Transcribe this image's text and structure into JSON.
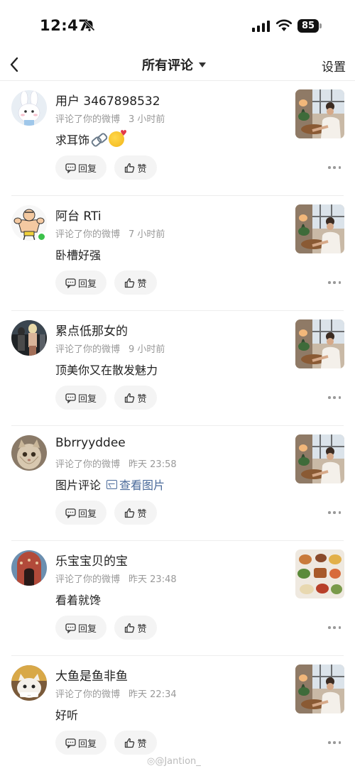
{
  "status_bar": {
    "time": "12:47",
    "battery": "85"
  },
  "nav": {
    "title": "所有评论",
    "settings": "设置"
  },
  "comments": [
    {
      "username": "用户 3467898532",
      "action": "评论了你的微博",
      "time": "3 小时前",
      "text": "求耳饰",
      "emoji": [
        "link-emoji",
        "kissing-face-emoji"
      ],
      "reply": "回复",
      "like": "赞",
      "thumb": "photo-man-at-window"
    },
    {
      "username": "阿台 RTi",
      "action": "评论了你的微博",
      "time": "7 小时前",
      "text": "卧槽好强",
      "reply": "回复",
      "like": "赞",
      "thumb": "photo-man-at-window",
      "online": true
    },
    {
      "username": "累点低那女的",
      "action": "评论了你的微博",
      "time": "9 小时前",
      "text": "顶美你又在散发魅力",
      "reply": "回复",
      "like": "赞",
      "thumb": "photo-man-at-window"
    },
    {
      "username": "Bbrryyddee",
      "action": "评论了你的微博",
      "time": "昨天 23:58",
      "text": "图片评论",
      "link": "查看图片",
      "reply": "回复",
      "like": "赞",
      "thumb": "photo-man-at-window"
    },
    {
      "username": "乐宝宝贝的宝",
      "action": "评论了你的微博",
      "time": "昨天 23:48",
      "text": "看着就馋",
      "reply": "回复",
      "like": "赞",
      "thumb": "photo-food-table"
    },
    {
      "username": "大鱼是鱼非鱼",
      "action": "评论了你的微博",
      "time": "昨天 22:34",
      "text": "好听",
      "reply": "回复",
      "like": "赞",
      "thumb": "photo-man-at-window"
    }
  ],
  "watermark": "@Jantion_",
  "colors": {
    "link": "#4a6a9a",
    "meta": "#999999",
    "online": "#3bc14a",
    "button_bg": "#f4f4f4"
  }
}
